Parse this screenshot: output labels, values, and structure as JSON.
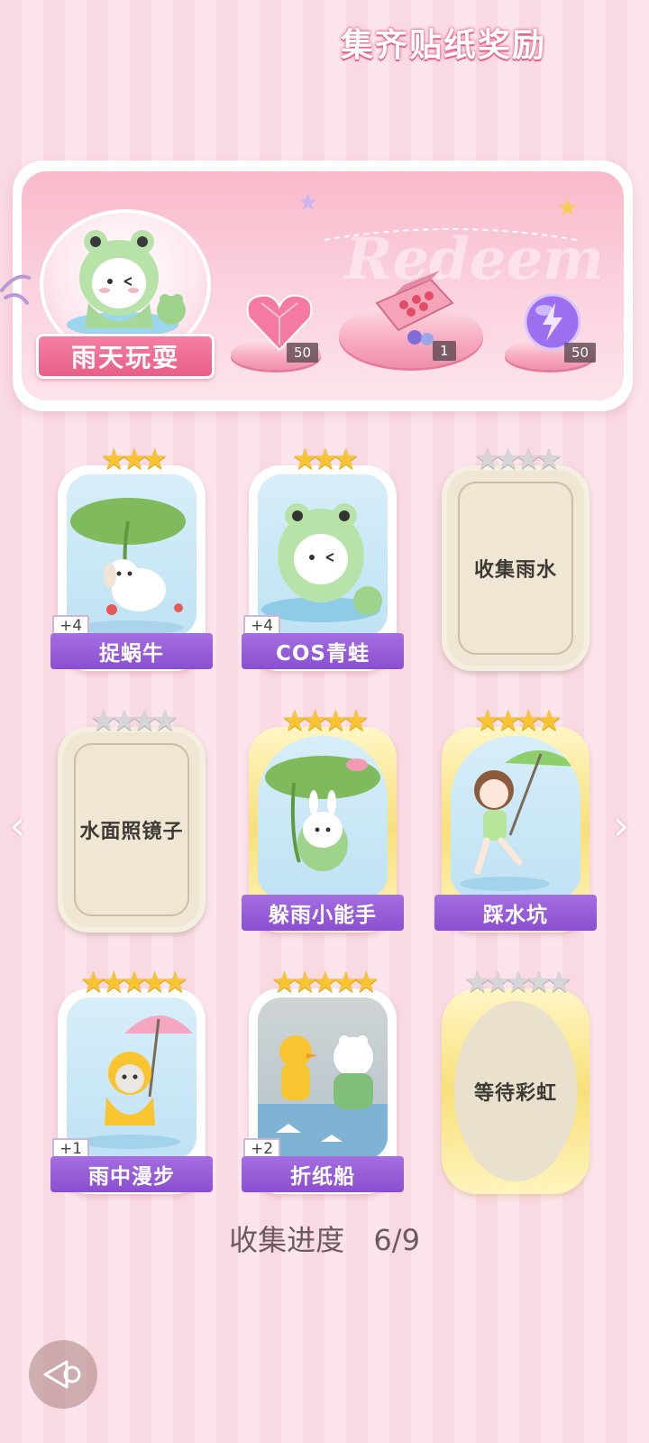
{
  "banner": {
    "title": "集齐贴纸奖励",
    "watermark": "Redeem",
    "theme_name": "雨天玩耍",
    "rewards": [
      {
        "icon": "pink-heart-gem-icon",
        "count": "50"
      },
      {
        "icon": "gift-box-icon",
        "count": "1"
      },
      {
        "icon": "purple-energy-orb-icon",
        "count": "50"
      }
    ]
  },
  "cards": [
    {
      "label": "捉蜗牛",
      "plus": "+4",
      "stars": 3,
      "state": "collected",
      "art": "puppy-under-leaf"
    },
    {
      "label": "COS青蛙",
      "plus": "+4",
      "stars": 3,
      "state": "collected",
      "art": "cat-in-frog-hood"
    },
    {
      "label": "收集雨水",
      "stars": 4,
      "state": "locked"
    },
    {
      "label": "水面照镜子",
      "stars": 4,
      "state": "locked"
    },
    {
      "label": "躲雨小能手",
      "stars": 4,
      "state": "collected-gold",
      "art": "bunny-frog-with-leaf"
    },
    {
      "label": "踩水坑",
      "stars": 4,
      "state": "collected-gold",
      "art": "girl-with-frog-umbrella"
    },
    {
      "label": "雨中漫步",
      "plus": "+1",
      "stars": 5,
      "state": "collected",
      "art": "cat-with-umbrella"
    },
    {
      "label": "折纸船",
      "plus": "+2",
      "stars": 5,
      "state": "collected",
      "art": "duck-and-bear-paper-boats"
    },
    {
      "label": "等待彩虹",
      "stars": 5,
      "state": "locked-gold"
    }
  ],
  "progress": {
    "label": "收集进度",
    "value": "6/9"
  },
  "colors": {
    "label_purple": "#8a4fd0",
    "star_gold": "#f8c531",
    "plate_pink": "#e85f89"
  }
}
